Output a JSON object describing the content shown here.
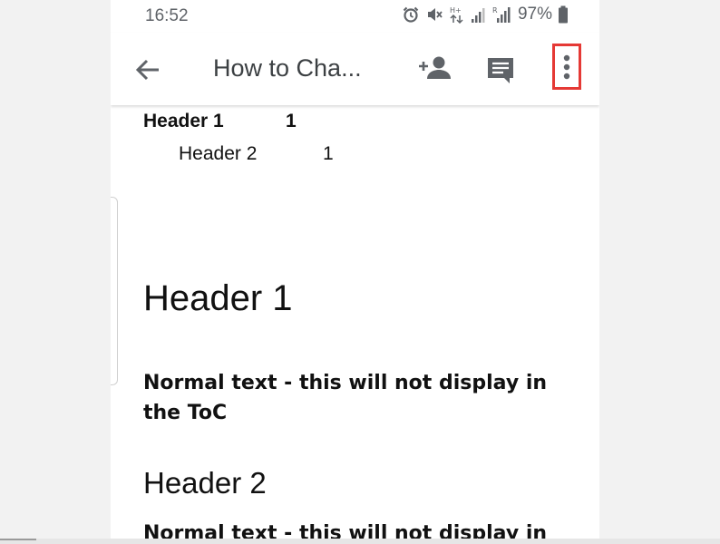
{
  "status_bar": {
    "time": "16:52",
    "battery": "97%",
    "icons": [
      "alarm-icon",
      "mute-icon",
      "data-arrows-icon",
      "signal-icon",
      "roaming-signal-icon",
      "battery-icon"
    ]
  },
  "toolbar": {
    "back_icon": "arrow-back-icon",
    "title": "How to Cha...",
    "share_icon": "add-person-icon",
    "comment_icon": "comment-icon",
    "more_icon": "more-vert-icon",
    "highlight_color": "#e53935"
  },
  "document": {
    "toc": [
      {
        "label": "Header 1",
        "page": "1"
      },
      {
        "label": "Header 2",
        "page": "1"
      }
    ],
    "heading1": "Header 1",
    "normal_text_1": "Normal text - this will not display in the ToC",
    "heading2": "Header 2",
    "normal_text_2": "Normal text - this will not display in"
  }
}
